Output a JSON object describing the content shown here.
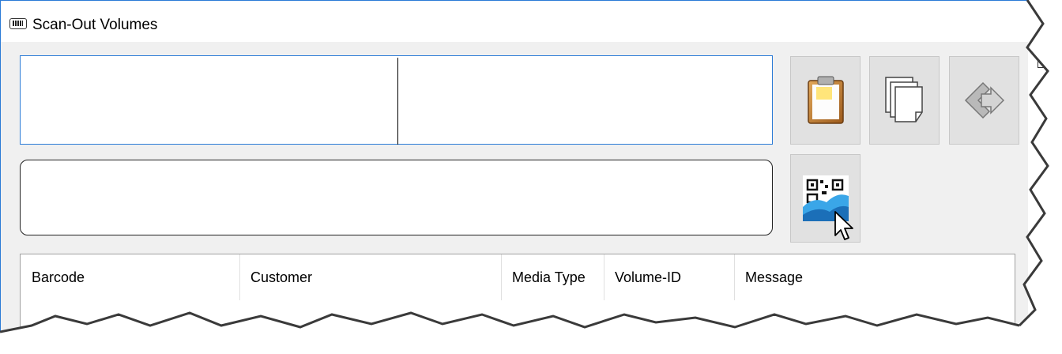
{
  "window": {
    "title": "Scan-Out Volumes",
    "title_icon": "barcode-scanner-icon"
  },
  "toolbar": {
    "buttons": [
      {
        "icon": "clipboard-paste-icon"
      },
      {
        "icon": "copy-pages-icon"
      },
      {
        "icon": "exit-arrow-icon"
      },
      {
        "icon": "qr-scan-icon"
      }
    ]
  },
  "list": {
    "columns": [
      "Barcode",
      "Customer",
      "Media Type",
      "Volume-ID",
      "Message"
    ]
  },
  "colors": {
    "accent": "#2b7bd6",
    "button_bg": "#e1e1e1",
    "window_bg": "#f0f0f0"
  }
}
